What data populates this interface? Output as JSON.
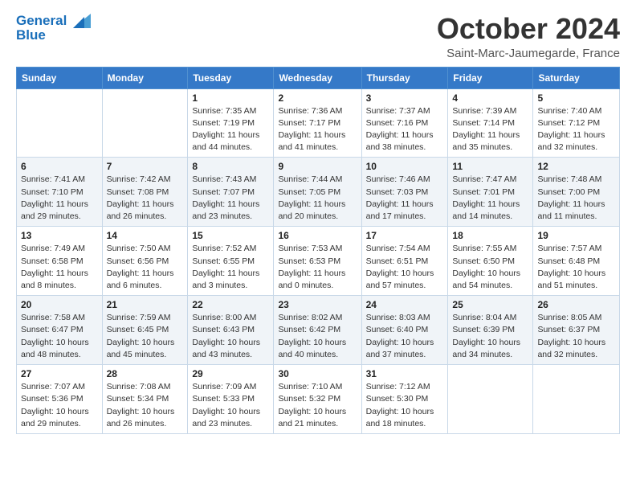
{
  "logo": {
    "line1": "General",
    "line2": "Blue"
  },
  "title": "October 2024",
  "location": "Saint-Marc-Jaumegarde, France",
  "headers": [
    "Sunday",
    "Monday",
    "Tuesday",
    "Wednesday",
    "Thursday",
    "Friday",
    "Saturday"
  ],
  "weeks": [
    [
      {
        "day": "",
        "sunrise": "",
        "sunset": "",
        "daylight": ""
      },
      {
        "day": "",
        "sunrise": "",
        "sunset": "",
        "daylight": ""
      },
      {
        "day": "1",
        "sunrise": "Sunrise: 7:35 AM",
        "sunset": "Sunset: 7:19 PM",
        "daylight": "Daylight: 11 hours and 44 minutes."
      },
      {
        "day": "2",
        "sunrise": "Sunrise: 7:36 AM",
        "sunset": "Sunset: 7:17 PM",
        "daylight": "Daylight: 11 hours and 41 minutes."
      },
      {
        "day": "3",
        "sunrise": "Sunrise: 7:37 AM",
        "sunset": "Sunset: 7:16 PM",
        "daylight": "Daylight: 11 hours and 38 minutes."
      },
      {
        "day": "4",
        "sunrise": "Sunrise: 7:39 AM",
        "sunset": "Sunset: 7:14 PM",
        "daylight": "Daylight: 11 hours and 35 minutes."
      },
      {
        "day": "5",
        "sunrise": "Sunrise: 7:40 AM",
        "sunset": "Sunset: 7:12 PM",
        "daylight": "Daylight: 11 hours and 32 minutes."
      }
    ],
    [
      {
        "day": "6",
        "sunrise": "Sunrise: 7:41 AM",
        "sunset": "Sunset: 7:10 PM",
        "daylight": "Daylight: 11 hours and 29 minutes."
      },
      {
        "day": "7",
        "sunrise": "Sunrise: 7:42 AM",
        "sunset": "Sunset: 7:08 PM",
        "daylight": "Daylight: 11 hours and 26 minutes."
      },
      {
        "day": "8",
        "sunrise": "Sunrise: 7:43 AM",
        "sunset": "Sunset: 7:07 PM",
        "daylight": "Daylight: 11 hours and 23 minutes."
      },
      {
        "day": "9",
        "sunrise": "Sunrise: 7:44 AM",
        "sunset": "Sunset: 7:05 PM",
        "daylight": "Daylight: 11 hours and 20 minutes."
      },
      {
        "day": "10",
        "sunrise": "Sunrise: 7:46 AM",
        "sunset": "Sunset: 7:03 PM",
        "daylight": "Daylight: 11 hours and 17 minutes."
      },
      {
        "day": "11",
        "sunrise": "Sunrise: 7:47 AM",
        "sunset": "Sunset: 7:01 PM",
        "daylight": "Daylight: 11 hours and 14 minutes."
      },
      {
        "day": "12",
        "sunrise": "Sunrise: 7:48 AM",
        "sunset": "Sunset: 7:00 PM",
        "daylight": "Daylight: 11 hours and 11 minutes."
      }
    ],
    [
      {
        "day": "13",
        "sunrise": "Sunrise: 7:49 AM",
        "sunset": "Sunset: 6:58 PM",
        "daylight": "Daylight: 11 hours and 8 minutes."
      },
      {
        "day": "14",
        "sunrise": "Sunrise: 7:50 AM",
        "sunset": "Sunset: 6:56 PM",
        "daylight": "Daylight: 11 hours and 6 minutes."
      },
      {
        "day": "15",
        "sunrise": "Sunrise: 7:52 AM",
        "sunset": "Sunset: 6:55 PM",
        "daylight": "Daylight: 11 hours and 3 minutes."
      },
      {
        "day": "16",
        "sunrise": "Sunrise: 7:53 AM",
        "sunset": "Sunset: 6:53 PM",
        "daylight": "Daylight: 11 hours and 0 minutes."
      },
      {
        "day": "17",
        "sunrise": "Sunrise: 7:54 AM",
        "sunset": "Sunset: 6:51 PM",
        "daylight": "Daylight: 10 hours and 57 minutes."
      },
      {
        "day": "18",
        "sunrise": "Sunrise: 7:55 AM",
        "sunset": "Sunset: 6:50 PM",
        "daylight": "Daylight: 10 hours and 54 minutes."
      },
      {
        "day": "19",
        "sunrise": "Sunrise: 7:57 AM",
        "sunset": "Sunset: 6:48 PM",
        "daylight": "Daylight: 10 hours and 51 minutes."
      }
    ],
    [
      {
        "day": "20",
        "sunrise": "Sunrise: 7:58 AM",
        "sunset": "Sunset: 6:47 PM",
        "daylight": "Daylight: 10 hours and 48 minutes."
      },
      {
        "day": "21",
        "sunrise": "Sunrise: 7:59 AM",
        "sunset": "Sunset: 6:45 PM",
        "daylight": "Daylight: 10 hours and 45 minutes."
      },
      {
        "day": "22",
        "sunrise": "Sunrise: 8:00 AM",
        "sunset": "Sunset: 6:43 PM",
        "daylight": "Daylight: 10 hours and 43 minutes."
      },
      {
        "day": "23",
        "sunrise": "Sunrise: 8:02 AM",
        "sunset": "Sunset: 6:42 PM",
        "daylight": "Daylight: 10 hours and 40 minutes."
      },
      {
        "day": "24",
        "sunrise": "Sunrise: 8:03 AM",
        "sunset": "Sunset: 6:40 PM",
        "daylight": "Daylight: 10 hours and 37 minutes."
      },
      {
        "day": "25",
        "sunrise": "Sunrise: 8:04 AM",
        "sunset": "Sunset: 6:39 PM",
        "daylight": "Daylight: 10 hours and 34 minutes."
      },
      {
        "day": "26",
        "sunrise": "Sunrise: 8:05 AM",
        "sunset": "Sunset: 6:37 PM",
        "daylight": "Daylight: 10 hours and 32 minutes."
      }
    ],
    [
      {
        "day": "27",
        "sunrise": "Sunrise: 7:07 AM",
        "sunset": "Sunset: 5:36 PM",
        "daylight": "Daylight: 10 hours and 29 minutes."
      },
      {
        "day": "28",
        "sunrise": "Sunrise: 7:08 AM",
        "sunset": "Sunset: 5:34 PM",
        "daylight": "Daylight: 10 hours and 26 minutes."
      },
      {
        "day": "29",
        "sunrise": "Sunrise: 7:09 AM",
        "sunset": "Sunset: 5:33 PM",
        "daylight": "Daylight: 10 hours and 23 minutes."
      },
      {
        "day": "30",
        "sunrise": "Sunrise: 7:10 AM",
        "sunset": "Sunset: 5:32 PM",
        "daylight": "Daylight: 10 hours and 21 minutes."
      },
      {
        "day": "31",
        "sunrise": "Sunrise: 7:12 AM",
        "sunset": "Sunset: 5:30 PM",
        "daylight": "Daylight: 10 hours and 18 minutes."
      },
      {
        "day": "",
        "sunrise": "",
        "sunset": "",
        "daylight": ""
      },
      {
        "day": "",
        "sunrise": "",
        "sunset": "",
        "daylight": ""
      }
    ]
  ]
}
